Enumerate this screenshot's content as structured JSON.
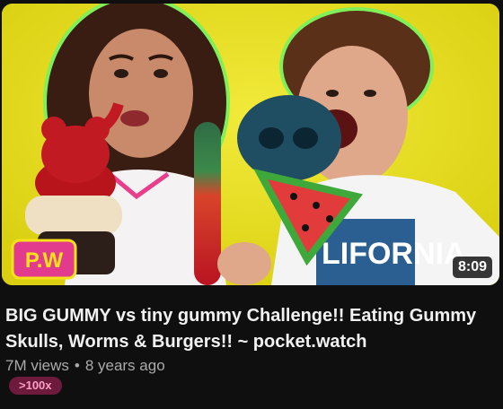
{
  "video": {
    "title": "BIG GUMMY vs tiny gummy Challenge!! Eating Gummy Skulls, Worms & Burgers!! ~ pocket.watch",
    "duration": "8:09",
    "views": "7M views",
    "separator": "•",
    "age": "8 years ago",
    "badge": ">100x"
  },
  "thumbnail": {
    "logo_text": "P.W",
    "shirt_text": "LIFORNIA",
    "colors": {
      "background": "#e7e01a",
      "glow": "#7ff05a",
      "bear": "#b8141c",
      "skull": "#1f4e63",
      "watermelon": "#e23b3b",
      "rind": "#3fa83a"
    }
  },
  "colors": {
    "page_bg": "#0f0f0f",
    "title": "#f1f1f1",
    "meta": "#aaaaaa",
    "badge_bg": "#6e1a3c",
    "badge_text": "#ff9ec8"
  }
}
